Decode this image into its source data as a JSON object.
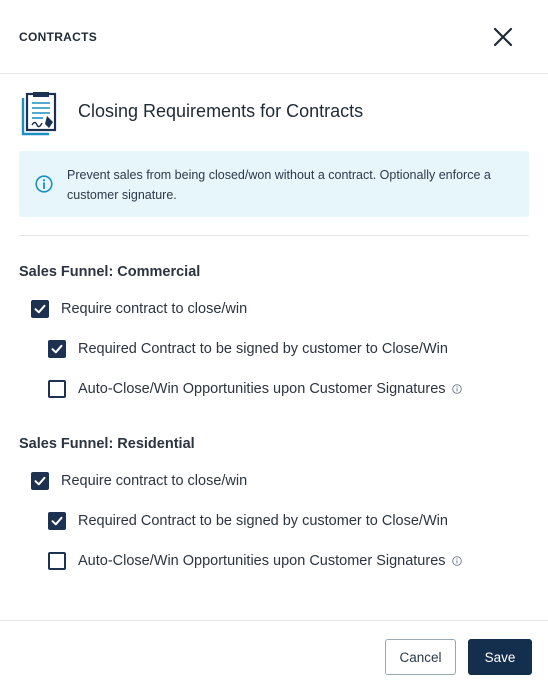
{
  "header": {
    "title": "CONTRACTS",
    "close_icon": "close-icon"
  },
  "main": {
    "title": "Closing Requirements for Contracts",
    "title_icon": "contract-document-icon"
  },
  "info": {
    "icon": "info-icon",
    "text": "Prevent sales from being closed/won without a contract. Optionally enforce a customer signature."
  },
  "sections": [
    {
      "title": "Sales Funnel: Commercial",
      "options": [
        {
          "label": "Require contract to close/win",
          "checked": true
        },
        {
          "label": "Required Contract to be signed by customer to Close/Win",
          "checked": true
        },
        {
          "label": "Auto-Close/Win Opportunities upon Customer Signatures",
          "checked": false,
          "hint_icon": "info-icon"
        }
      ]
    },
    {
      "title": "Sales Funnel: Residential",
      "options": [
        {
          "label": "Require contract to close/win",
          "checked": true
        },
        {
          "label": "Required Contract to be signed by customer to Close/Win",
          "checked": true
        },
        {
          "label": "Auto-Close/Win Opportunities upon Customer Signatures",
          "checked": false,
          "hint_icon": "info-icon"
        }
      ]
    }
  ],
  "footer": {
    "cancel_label": "Cancel",
    "save_label": "Save"
  },
  "colors": {
    "primary": "#142e4e",
    "info_bg": "#e6f6fb",
    "info_icon": "#1a8fc4",
    "divider": "#e3e6ea"
  }
}
